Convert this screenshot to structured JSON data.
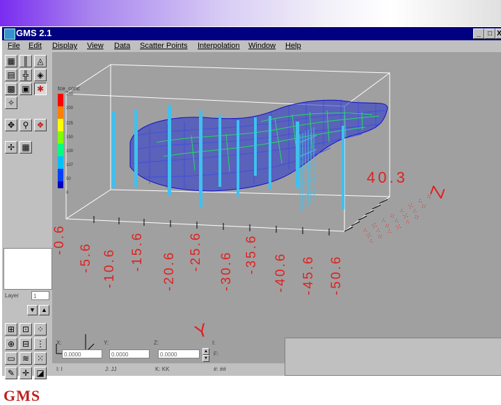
{
  "window": {
    "title": "GMS 2.1",
    "min_label": "_",
    "max_label": "□",
    "close_label": "X"
  },
  "menu": [
    "File",
    "Edit",
    "Display",
    "View",
    "Data",
    "Scatter Points",
    "Interpolation",
    "Window",
    "Help"
  ],
  "legend": {
    "title": "tce_conc",
    "ticks": [
      "250",
      "200",
      "225",
      "150",
      "100",
      "107",
      "50",
      "0"
    ]
  },
  "axis": {
    "y_title": "Y",
    "z_title": "Z",
    "y_ticks": [
      "-0.6",
      "-5.6",
      "-10.6",
      "-15.6",
      "-20.6",
      "-25.6",
      "-30.6",
      "-35.6",
      "-40.6",
      "-45.6",
      "-50.6"
    ],
    "z_value": "40.3"
  },
  "toolpanel": {
    "layer_label": "Layer",
    "layer_value": "1",
    "logo": "GMS"
  },
  "status": {
    "x_label": "X:",
    "y_label": "Y:",
    "z_label": "Z:",
    "i_label": "I:",
    "x_value": "0.0000",
    "y_value": "0.0000",
    "z_value": "0.0000",
    "f_label": "F:",
    "row_labels": [
      "I: I",
      "J: JJ",
      "K: KK",
      "#: ##"
    ]
  },
  "colors": {
    "titlebar": "#000080",
    "viewport": "#a0a0a0",
    "mesh": "#1010c8",
    "contour": "#20e060",
    "wells": "#40c0f0",
    "labels": "#e02020"
  }
}
